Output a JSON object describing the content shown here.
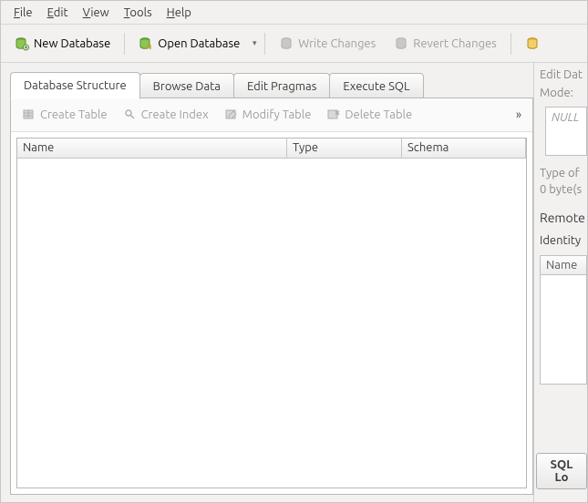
{
  "menubar": {
    "file": {
      "label": "File",
      "hotkey_index": 0
    },
    "edit": {
      "label": "Edit",
      "hotkey_index": 0
    },
    "view": {
      "label": "View",
      "hotkey_index": 0
    },
    "tools": {
      "label": "Tools",
      "hotkey_index": 0
    },
    "help": {
      "label": "Help",
      "hotkey_index": 0
    }
  },
  "toolbar": {
    "new_db": {
      "label": "New Database",
      "enabled": true
    },
    "open_db": {
      "label": "Open Database",
      "enabled": true
    },
    "write_changes": {
      "label": "Write Changes",
      "enabled": false
    },
    "revert_changes": {
      "label": "Revert Changes",
      "enabled": false
    }
  },
  "tabs": {
    "db_structure": {
      "label": "Database Structure",
      "active": true
    },
    "browse_data": {
      "label": "Browse Data",
      "active": false
    },
    "edit_pragmas": {
      "label": "Edit Pragmas",
      "active": false
    },
    "execute_sql": {
      "label": "Execute SQL",
      "active": false
    }
  },
  "structure": {
    "toolbar": {
      "create_table": {
        "label": "Create Table",
        "enabled": false
      },
      "create_index": {
        "label": "Create Index",
        "enabled": false
      },
      "modify_table": {
        "label": "Modify Table",
        "enabled": false
      },
      "delete_table": {
        "label": "Delete Table",
        "enabled": false
      }
    },
    "columns": {
      "name": "Name",
      "type": "Type",
      "schema": "Schema"
    },
    "rows": []
  },
  "side": {
    "edit_cell_title": "Edit Dat",
    "mode_label": "Mode:",
    "null_placeholder": "NULL",
    "type_line": "Type of",
    "size_line": "0 byte(s",
    "remote_title": "Remote",
    "identity_label": "Identity",
    "name_header": "Name",
    "sql_log_button": "SQL Lo"
  }
}
